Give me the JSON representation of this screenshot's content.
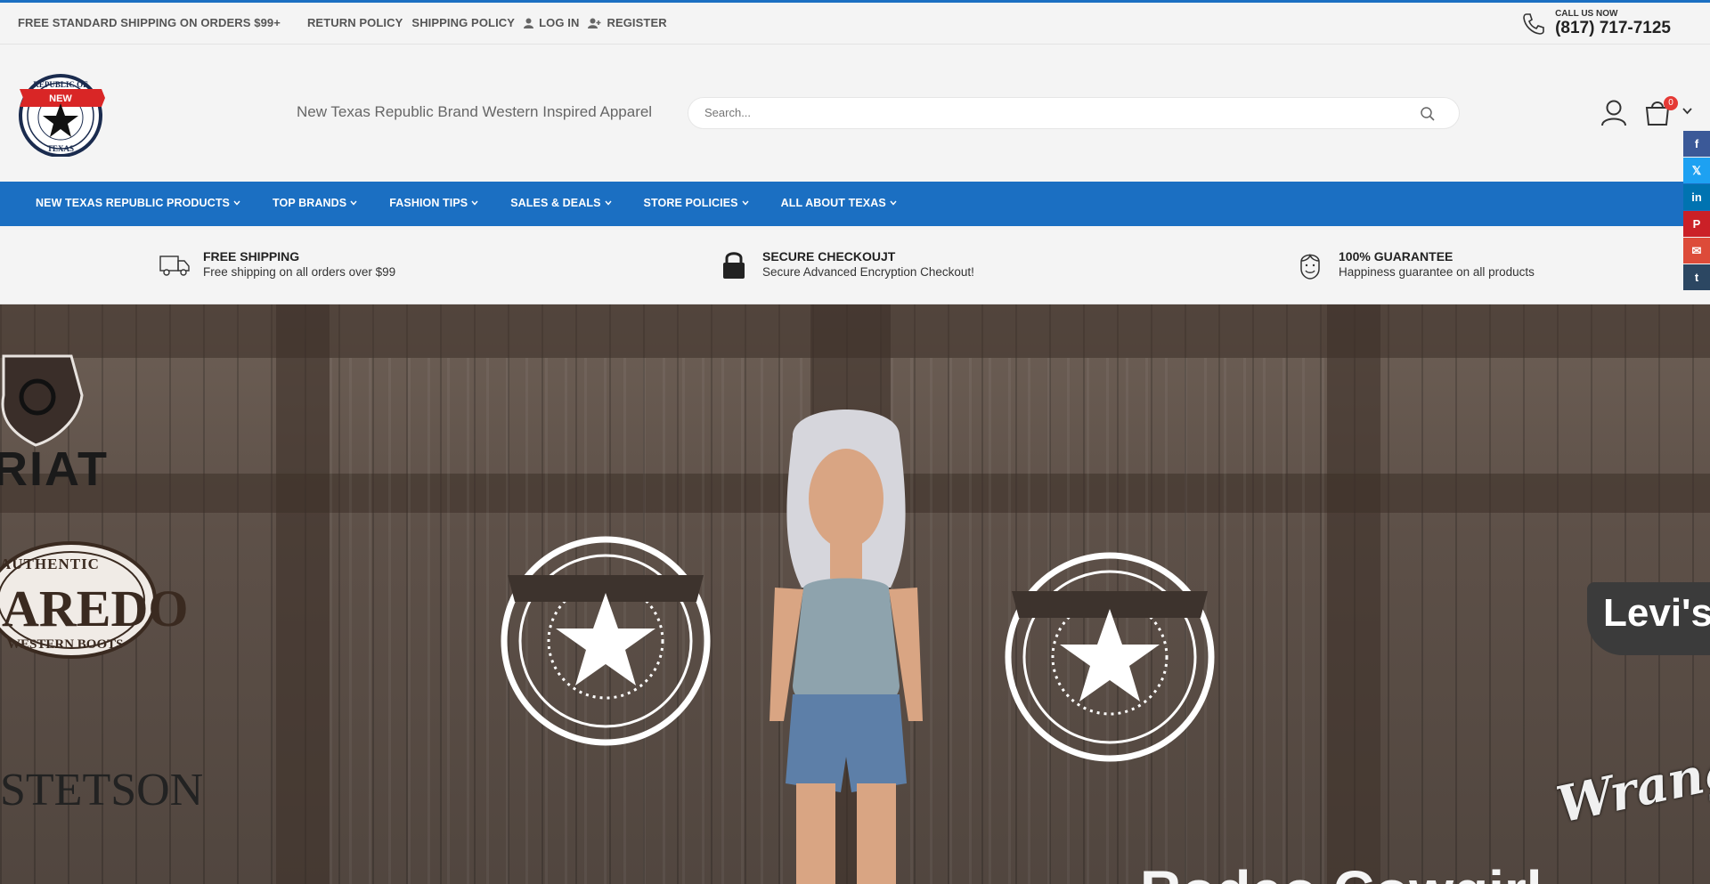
{
  "topbar": {
    "free_shipping": "FREE STANDARD SHIPPING ON ORDERS $99+",
    "return_policy": "RETURN POLICY",
    "shipping_policy": "SHIPPING POLICY",
    "login": "LOG IN",
    "register": "REGISTER",
    "call_label": "CALL US NOW",
    "phone": "(817) 717-7125"
  },
  "header": {
    "logo_text": [
      "REPUBLIC OF",
      "NEW",
      "TEXAS"
    ],
    "tagline": "New Texas Republic Brand Western Inspired Apparel",
    "search_placeholder": "Search...",
    "cart_count": "0"
  },
  "nav": {
    "items": [
      {
        "label": "NEW TEXAS REPUBLIC PRODUCTS"
      },
      {
        "label": "TOP BRANDS"
      },
      {
        "label": "FASHION TIPS"
      },
      {
        "label": "SALES & DEALS"
      },
      {
        "label": "STORE POLICIES"
      },
      {
        "label": "ALL ABOUT TEXAS"
      }
    ]
  },
  "features": [
    {
      "title": "FREE SHIPPING",
      "desc": "Free shipping on all orders over $99",
      "icon": "truck-icon"
    },
    {
      "title": "SECURE CHECKOUJT",
      "desc": "Secure Advanced Encryption Checkout!",
      "icon": "lock-icon"
    },
    {
      "title": "100% GUARANTEE",
      "desc": "Happiness guarantee on all products",
      "icon": "smiley-face-icon"
    }
  ],
  "hero": {
    "brands": [
      "RIAT",
      "AREDO",
      "AUTHENTIC",
      "WESTERN BOOTS",
      "STETSON",
      "Levi's",
      "Wrangler"
    ],
    "title_partial": "Rodeo Cowgirl"
  },
  "share": [
    {
      "icon": "facebook-icon",
      "glyph": "f",
      "color": "#3b5998"
    },
    {
      "icon": "x-twitter-icon",
      "glyph": "𝕏",
      "color": "#1da1f2"
    },
    {
      "icon": "linkedin-icon",
      "glyph": "in",
      "color": "#0073b1"
    },
    {
      "icon": "pinterest-icon",
      "glyph": "P",
      "color": "#cb2027"
    },
    {
      "icon": "email-icon",
      "glyph": "✉",
      "color": "#dd4b39"
    },
    {
      "icon": "tumblr-icon",
      "glyph": "t",
      "color": "#2c4762"
    }
  ],
  "colors": {
    "brand_blue": "#1b6fc2",
    "badge_red": "#e53935"
  }
}
